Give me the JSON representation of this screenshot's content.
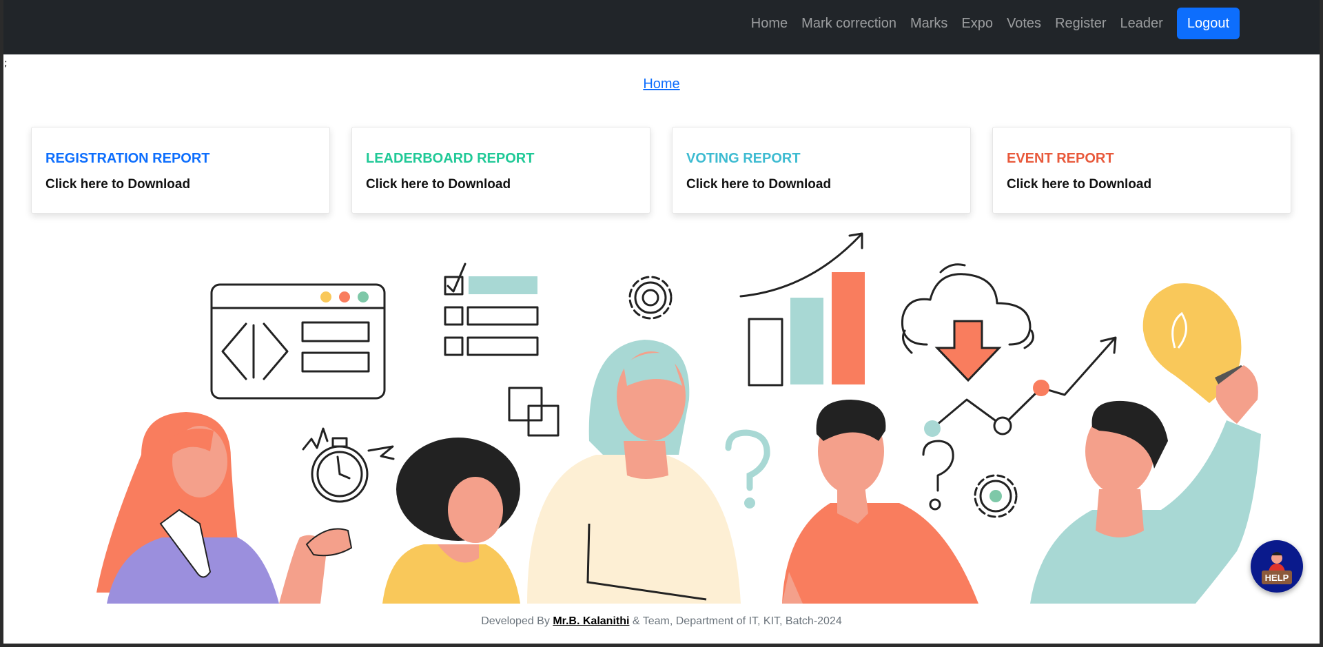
{
  "navbar": {
    "links": [
      "Home",
      "Mark correction",
      "Marks",
      "Expo",
      "Votes",
      "Register",
      "Leader"
    ],
    "logout_label": "Logout"
  },
  "stray_text": ";",
  "home_link": "Home",
  "cards": [
    {
      "title": "REGISTRATION REPORT",
      "subtitle": "Click here to Download",
      "color": "#0d6efd"
    },
    {
      "title": "LEADERBOARD REPORT",
      "subtitle": "Click here to Download",
      "color": "#20c997"
    },
    {
      "title": "VOTING REPORT",
      "subtitle": "Click here to Download",
      "color": "#3dbbd1"
    },
    {
      "title": "EVENT REPORT",
      "subtitle": "Click here to Download",
      "color": "#e8593b"
    }
  ],
  "footer": {
    "prefix": "Developed By",
    "author": "Mr.B. Kalanithi",
    "suffix": "& Team, Department of IT, KIT, Batch-2024"
  },
  "help_button": {
    "label": "HELP",
    "icon": "help-desk-person-icon"
  },
  "illustration": {
    "icon": "team-collaboration-illustration"
  },
  "colors": {
    "navbar_bg": "#212529",
    "primary": "#0d6efd",
    "teal": "#a8d8d4",
    "coral": "#f97d5e",
    "yellow": "#f9c85a",
    "purple": "#9b8fdd"
  }
}
